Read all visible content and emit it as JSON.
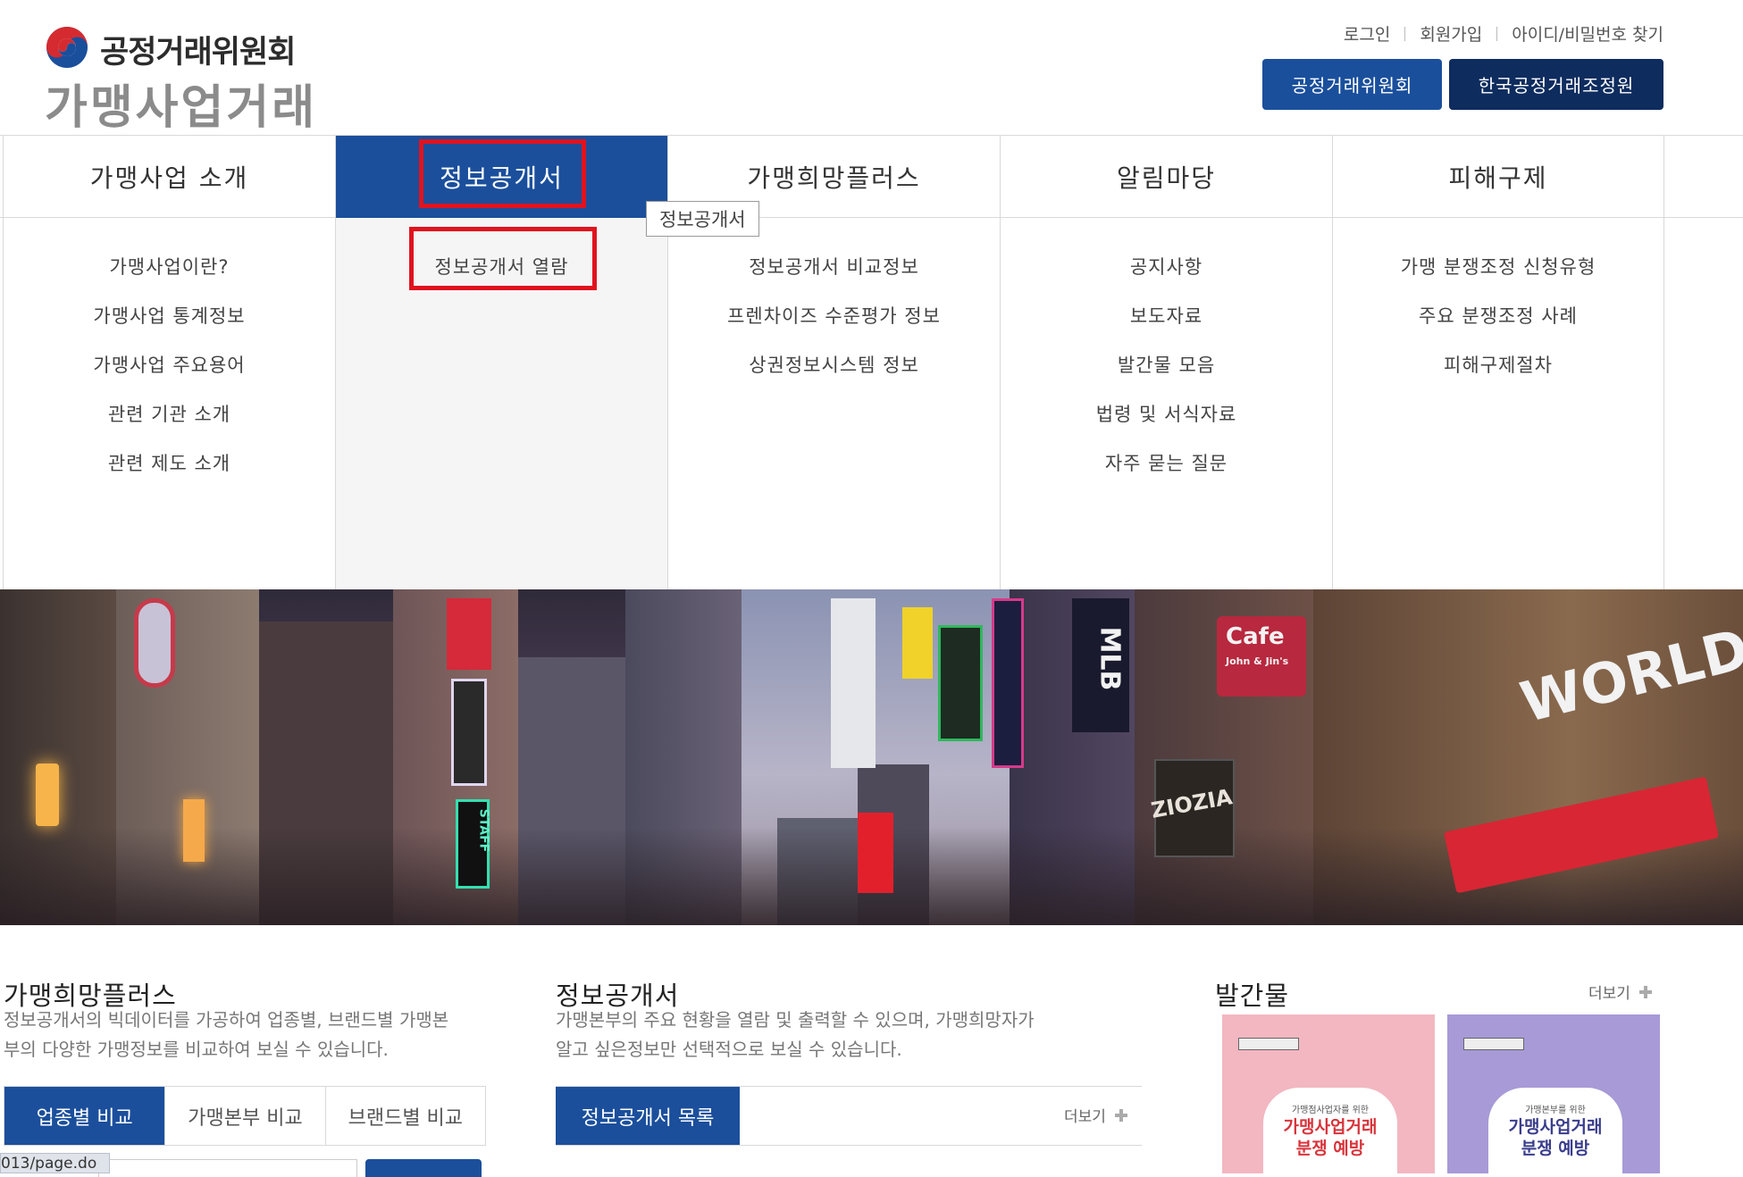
{
  "header": {
    "org_name": "공정거래위원회",
    "site_title": "가맹사업거래",
    "util_links": [
      "로그인",
      "회원가입",
      "아이디/비밀번호 찾기"
    ],
    "site_buttons": [
      "공정거래위원회",
      "한국공정거래조정원"
    ]
  },
  "gnb": {
    "items": [
      "가맹사업 소개",
      "정보공개서",
      "가맹희망플러스",
      "알림마당",
      "피해구제"
    ],
    "active_index": 1,
    "tooltip": "정보공개서"
  },
  "submenu": {
    "columns": [
      [
        "가맹사업이란?",
        "가맹사업 통계정보",
        "가맹사업 주요용어",
        "관련 기관 소개",
        "관련 제도 소개"
      ],
      [
        "정보공개서 열람"
      ],
      [
        "정보공개서 비교정보",
        "프렌차이즈 수준평가 정보",
        "상권정보시스템 정보"
      ],
      [
        "공지사항",
        "보도자료",
        "발간물 모음",
        "법령 및 서식자료",
        "자주 묻는 질문"
      ],
      [
        "가맹 분쟁조정 신청유형",
        "주요 분쟁조정 사례",
        "피해구제절차"
      ]
    ]
  },
  "banner": {
    "signs": [
      "Cafe",
      "John & Jin's",
      "WORLD",
      "ZIOZIA",
      "STAFF",
      "MLB"
    ]
  },
  "sections": {
    "plus": {
      "title": "가맹희망플러스",
      "desc_lines": [
        "정보공개서의 빅데이터를 가공하여 업종별, 브랜드별 가맹본",
        "부의 다양한 가맹정보를 비교하여 보실 수 있습니다."
      ],
      "tabs": [
        "업종별 비교",
        "가맹본부 비교",
        "브랜드별 비교"
      ]
    },
    "disclosure": {
      "title": "정보공개서",
      "desc_lines": [
        "가맹본부의 주요 현황을 열람 및 출력할 수 있으며, 가맹희망자가",
        "알고 싶은정보만 선택적으로 보실 수 있습니다."
      ],
      "tab": "정보공개서 목록",
      "more": "더보기"
    },
    "publications": {
      "title": "발간물",
      "more": "더보기",
      "books": [
        {
          "small": "가맹점사업자를 위한",
          "line1": "가맹사업거래",
          "line2": "분쟁 예방",
          "color": "#d8343c"
        },
        {
          "small": "가맹본부를 위한",
          "line1": "가맹사업거래",
          "line2": "분쟁 예방",
          "color": "#3a3d8c"
        }
      ]
    }
  },
  "status_url": "013/page.do"
}
